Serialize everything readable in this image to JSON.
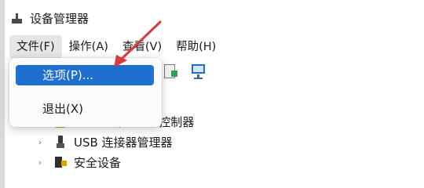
{
  "window": {
    "title": "设备管理器",
    "icon": "device-manager-icon"
  },
  "menubar": {
    "items": [
      {
        "label": "文件(F)",
        "active": true
      },
      {
        "label": "操作(A)",
        "active": false
      },
      {
        "label": "查看(V)",
        "active": false
      },
      {
        "label": "帮助(H)",
        "active": false
      }
    ]
  },
  "dropdown": {
    "options_label": "选项(P)...",
    "exit_label": "退出(X)",
    "highlight_color": "#1f6fd1"
  },
  "toolbar": {
    "icons": [
      "update-driver-icon",
      "monitor-icon"
    ]
  },
  "tree": {
    "items": [
      {
        "label": "IDE ATA/ATAPI 控制器",
        "icon": "ide-controller-icon"
      },
      {
        "label": "USB 连接器管理器",
        "icon": "usb-connector-icon"
      },
      {
        "label": "安全设备",
        "icon": "security-device-icon"
      }
    ]
  },
  "annotation": {
    "arrow_color": "#d93a3a"
  }
}
